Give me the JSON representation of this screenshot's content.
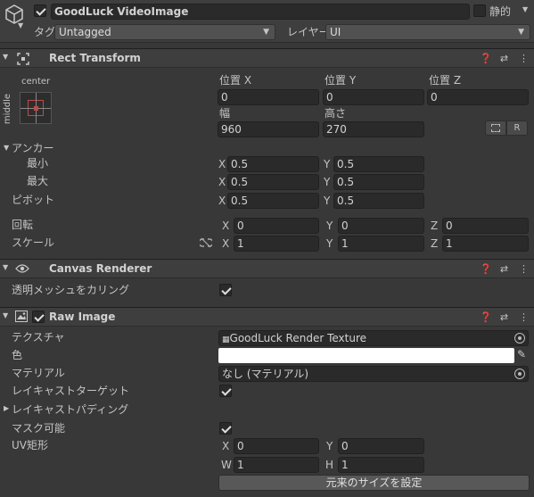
{
  "gameobject": {
    "name": "GoodLuck VideoImage",
    "active": true,
    "static_label": "静的",
    "tag_label": "タグ",
    "tag_value": "Untagged",
    "layer_label": "レイヤー",
    "layer_value": "UI"
  },
  "rect_transform": {
    "title": "Rect Transform",
    "anchor_preset_top": "center",
    "anchor_preset_side": "middle",
    "pos_x_label": "位置 X",
    "pos_y_label": "位置 Y",
    "pos_z_label": "位置 Z",
    "pos_x": "0",
    "pos_y": "0",
    "pos_z": "0",
    "width_label": "幅",
    "height_label": "高さ",
    "width": "960",
    "height": "270",
    "raw_edit_label": "R",
    "anchors_label": "アンカー",
    "min_label": "最小",
    "max_label": "最大",
    "min_x": "0.5",
    "min_y": "0.5",
    "max_x": "0.5",
    "max_y": "0.5",
    "pivot_label": "ピボット",
    "pivot_x": "0.5",
    "pivot_y": "0.5",
    "rotation_label": "回転",
    "rot_x": "0",
    "rot_y": "0",
    "rot_z": "0",
    "scale_label": "スケール",
    "scale_x": "1",
    "scale_y": "1",
    "scale_z": "1",
    "axis_x": "X",
    "axis_y": "Y",
    "axis_z": "Z"
  },
  "canvas_renderer": {
    "title": "Canvas Renderer",
    "cull_label": "透明メッシュをカリング",
    "cull_checked": true
  },
  "raw_image": {
    "title": "Raw Image",
    "enabled": true,
    "texture_label": "テクスチャ",
    "texture_value": "GoodLuck Render Texture",
    "color_label": "色",
    "color_value": "#ffffff",
    "material_label": "マテリアル",
    "material_value": "なし (マテリアル)",
    "raycast_target_label": "レイキャストターゲット",
    "raycast_padding_label": "レイキャストパディング",
    "maskable_label": "マスク可能",
    "uv_rect_label": "UV矩形",
    "uv_x": "0",
    "uv_y": "0",
    "uv_w": "1",
    "uv_h": "1",
    "axis_w": "W",
    "axis_h": "H",
    "native_size_button": "元来のサイズを設定"
  }
}
